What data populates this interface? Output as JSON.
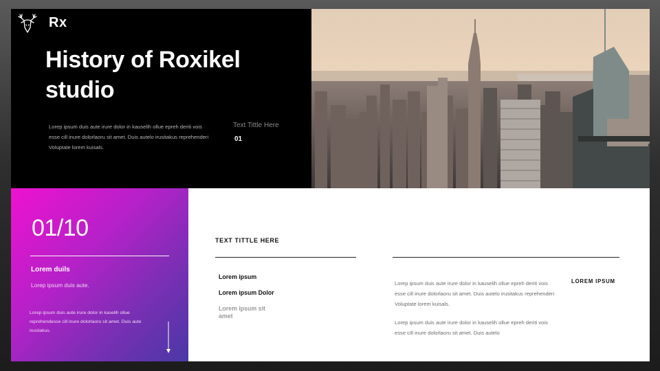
{
  "brand": {
    "name": "Rx",
    "logo_icon": "deer-head-icon"
  },
  "title": "History of Roxikel studio",
  "intro": "Lorep  ipsum duis aute irure dolor in kauselih ollue epreh deriti vois esse cill inure dolorlaoru sit amet. Duis autelo irusitakus reprehenderi Voluptate lorem kuisals.",
  "side": {
    "label": "Text Tittle Here",
    "number": "01"
  },
  "photo": {
    "subject": "city-skyline-photo"
  },
  "gradient_panel": {
    "counter": "01/10",
    "heading": "Lorem duils",
    "subheading": "Lorep  ipsum duis aute.",
    "body": "Lorep  ipsum duis aute irure dolor in kaselih ollue reprehendesse cill inure dolorlaoru sit amet. Duis aute irusitakus.",
    "arrow_icon": "arrow-down-icon"
  },
  "column1": {
    "title": "TEXT TITTLE HERE",
    "items": [
      "Lorem ipsum",
      "Lorem ipsum  Dolor",
      "Lorem ipsum  sit amet"
    ]
  },
  "column2": {
    "paragraph1": "Lorep  ipsum duis aute irure dolor in kauselih ollue epreh deriti vois esse cill inure dolorlaoru sit amet. Duis autelo irusitakus reprehenderi Voluptate lorem kuisals.",
    "paragraph2": "Lorep  ipsum duis aute irure dolor in kauselih ollue epreh deriti vois esse cill inure dolorlaoru sit amet. Duis autelo",
    "label": "LOREM IPSUM"
  },
  "colors": {
    "gradient_start": "#ee12cf",
    "gradient_end": "#4a38a6",
    "dark_panel": "#000000"
  }
}
